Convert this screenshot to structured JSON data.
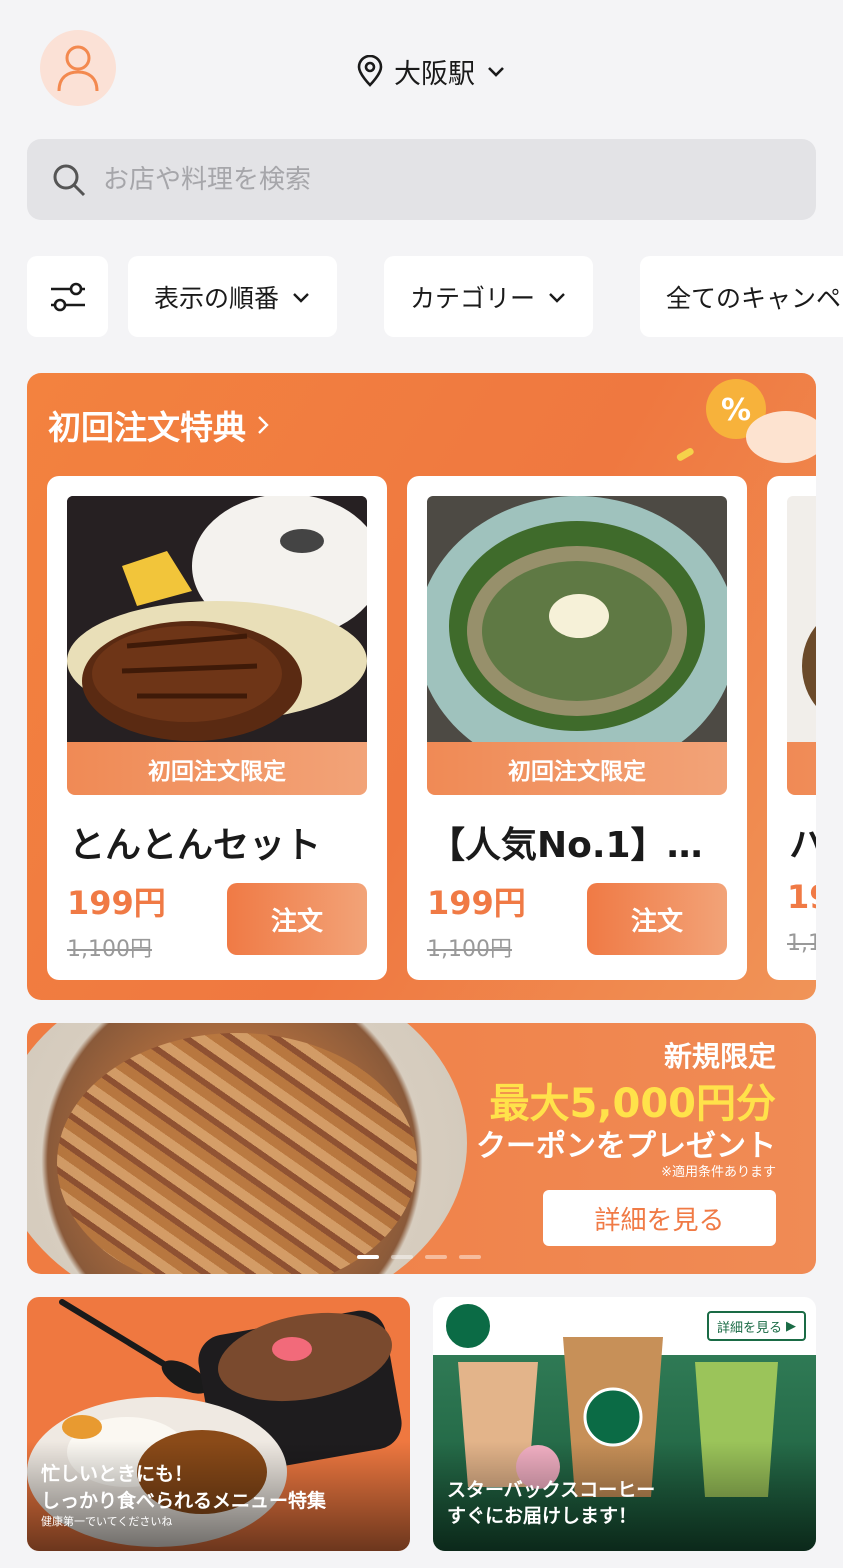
{
  "header": {
    "location": "大阪駅"
  },
  "search": {
    "placeholder": "お店や料理を検索"
  },
  "filters": {
    "sort_label": "表示の順番",
    "category_label": "カテゴリー",
    "campaign_label": "全てのキャンペーン"
  },
  "promo": {
    "title": "初回注文特典",
    "cards": [
      {
        "tag": "初回注文限定",
        "name": "とんとんセット",
        "price": "199円",
        "original_price": "1,100円",
        "button": "注文"
      },
      {
        "tag": "初回注文限定",
        "name": "【人気No.1】…",
        "price": "199円",
        "original_price": "1,100円",
        "button": "注文"
      },
      {
        "tag": "",
        "name": "ハ",
        "price": "19",
        "original_price": "1,1",
        "button": ""
      }
    ]
  },
  "banner": {
    "line1": "新規限定",
    "line2": "最大5,000円分",
    "line3": "クーポンをプレゼント",
    "note": "※適用条件あります",
    "button": "詳細を見る"
  },
  "tiles": {
    "left": {
      "line1": "忙しいときにも！",
      "line2": "しっかり食べられるメニュー特集",
      "sub": "健康第一でいてくださいね"
    },
    "right": {
      "badge": "詳細を見る",
      "line1": "スターバックスコーヒー",
      "line2": "すぐにお届けします！"
    }
  },
  "colors": {
    "accent": "#f07a45",
    "highlight": "#ffe24a",
    "background": "#f4f4f6"
  },
  "icons": [
    "user-icon",
    "location-pin-icon",
    "chevron-down-icon",
    "search-icon",
    "filter-sliders-icon",
    "chevron-right-icon",
    "percent-badge-icon"
  ]
}
